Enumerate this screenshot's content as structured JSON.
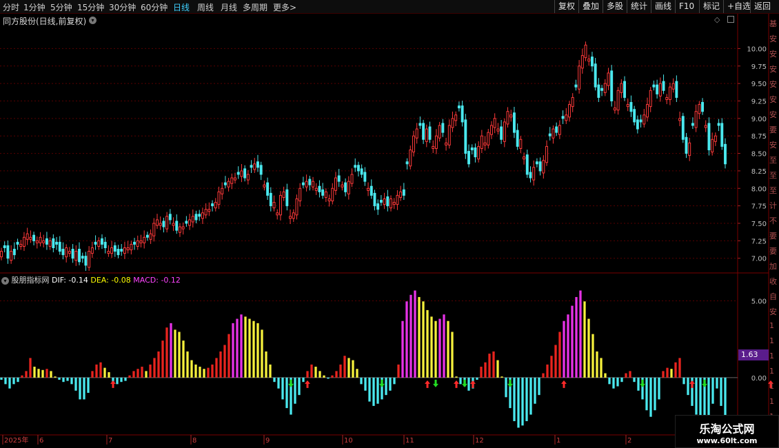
{
  "toolbar": {
    "periods": [
      "分时",
      "1分钟",
      "5分钟",
      "15分钟",
      "30分钟",
      "60分钟",
      "日线",
      "周线",
      "月线",
      "多周期",
      "更多"
    ],
    "active_period": "日线",
    "more_arrow": ">",
    "right_buttons": [
      "复权",
      "叠加",
      "多股",
      "统计",
      "画线",
      "F10",
      "标记",
      "+自选",
      "返回"
    ]
  },
  "stock": {
    "title": "同方股份(日线,前复权)"
  },
  "indicator": {
    "name": "股朋指标网",
    "dif_label": "DIF: -0.14",
    "dea_label": "DEA: -0.08",
    "macd_label": "MACD: -0.12",
    "current_value_tag": "1.63",
    "colors": {
      "dif": "#ffffff",
      "dea": "#ffff00",
      "macd": "#ff44ff",
      "tag_bg": "#5a1c8c"
    }
  },
  "side_panel_chars": [
    "基",
    "安",
    "安",
    "安",
    "安",
    "安",
    "安",
    "要",
    "安",
    "至",
    "至",
    "至",
    "计",
    "不",
    "要",
    "要",
    "加",
    "收",
    "自",
    "安",
    "1",
    "1",
    "1",
    "1",
    "1",
    "1",
    "1"
  ],
  "watermark": {
    "line1": "乐淘公式网",
    "line2": "www.60lt.com"
  },
  "colors": {
    "up": "#ff3a3a",
    "down": "#4ae8ee",
    "grid": "#5a0000",
    "bar_yellow": "#f5f03c",
    "bar_red": "#e8241e",
    "bar_magenta": "#e632e6",
    "bar_cyan": "#4ae8ee",
    "arrow_up": "#ff2a2a",
    "arrow_down": "#22dd22"
  },
  "chart_data": [
    {
      "type": "candlestick",
      "title": "同方股份(日线,前复权)",
      "ylim": [
        6.8,
        10.3
      ],
      "y_ticks": [
        7.0,
        7.25,
        7.5,
        7.75,
        8.0,
        8.25,
        8.5,
        8.75,
        9.0,
        9.25,
        9.5,
        9.75,
        10.0
      ],
      "y_tick_labels": [
        "7.00",
        "7.25",
        "7.50",
        "7.75",
        "8.00",
        "8.25",
        "8.50",
        "8.75",
        "9.00",
        "9.25",
        "9.50",
        "9.75",
        "10.00"
      ],
      "x_labels": [
        "2025年",
        "6",
        "7",
        "8",
        "9",
        "10",
        "11",
        "12",
        "1",
        "2"
      ],
      "close": [
        7.1,
        7.15,
        7.0,
        7.1,
        7.05,
        7.2,
        7.2,
        7.3,
        7.35,
        7.3,
        7.25,
        7.25,
        7.3,
        7.25,
        7.2,
        7.25,
        7.15,
        7.2,
        7.1,
        7.05,
        7.15,
        7.1,
        7.0,
        7.1,
        6.95,
        7.0,
        6.9,
        7.1,
        7.15,
        7.2,
        7.25,
        7.2,
        7.15,
        7.1,
        7.15,
        7.1,
        7.05,
        7.1,
        7.15,
        7.15,
        7.2,
        7.2,
        7.25,
        7.25,
        7.3,
        7.3,
        7.35,
        7.5,
        7.55,
        7.5,
        7.45,
        7.6,
        7.55,
        7.5,
        7.4,
        7.45,
        7.45,
        7.5,
        7.55,
        7.6,
        7.55,
        7.6,
        7.65,
        7.7,
        7.7,
        7.75,
        7.8,
        7.95,
        8.0,
        8.05,
        8.1,
        8.15,
        8.15,
        8.2,
        8.25,
        8.15,
        8.2,
        8.3,
        8.35,
        8.3,
        8.2,
        8.05,
        7.9,
        7.75,
        7.8,
        7.65,
        7.9,
        7.95,
        7.75,
        7.6,
        7.65,
        7.85,
        8.0,
        8.05,
        8.1,
        8.05,
        8.1,
        8.0,
        7.95,
        7.9,
        7.95,
        7.85,
        8.0,
        8.15,
        8.1,
        8.05,
        7.95,
        8.1,
        8.2,
        8.3,
        8.25,
        8.2,
        8.1,
        8.0,
        7.9,
        7.75,
        7.7,
        7.8,
        7.85,
        7.75,
        7.85,
        7.8,
        7.9,
        7.95,
        7.9,
        8.35,
        8.55,
        8.75,
        8.85,
        8.9,
        8.7,
        8.85,
        8.7,
        8.6,
        8.75,
        8.9,
        8.8,
        8.65,
        8.9,
        9.0,
        9.05,
        9.15,
        8.95,
        8.5,
        8.35,
        8.55,
        8.45,
        8.6,
        8.75,
        8.65,
        8.8,
        8.9,
        9.0,
        8.85,
        8.7,
        8.95,
        9.1,
        9.05,
        8.8,
        8.6,
        8.7,
        8.45,
        8.2,
        8.15,
        8.3,
        8.35,
        8.25,
        8.4,
        8.6,
        8.75,
        8.85,
        8.8,
        8.9,
        9.0,
        9.05,
        9.2,
        9.3,
        9.45,
        9.75,
        9.9,
        10.05,
        9.85,
        9.75,
        9.45,
        9.3,
        9.4,
        9.5,
        9.65,
        9.25,
        9.15,
        9.4,
        9.5,
        9.3,
        9.2,
        9.1,
        8.95,
        8.85,
        8.95,
        9.05,
        9.2,
        9.4,
        9.45,
        9.35,
        9.5,
        9.4,
        9.3,
        9.45,
        9.5,
        9.3,
        9.0,
        8.7,
        8.5,
        8.65,
        8.9,
        9.1,
        9.2,
        9.1,
        8.9,
        8.55,
        8.7,
        8.75,
        8.9,
        8.6,
        8.35
      ],
      "overlay_series": [
        {
          "name": "DIF",
          "color": "#ffffff"
        },
        {
          "name": "DEA",
          "color": "#ffff00"
        }
      ]
    },
    {
      "type": "bar",
      "title": "股朋指标网",
      "ylim": [
        -2.6,
        4.3
      ],
      "y_ticks": [
        0.0,
        5.0
      ],
      "y_tick_labels": [
        "0.00",
        "5.00"
      ],
      "values": [
        -0.1,
        -0.3,
        -0.5,
        -0.3,
        -0.2,
        0.1,
        0.3,
        0.9,
        0.5,
        0.4,
        0.35,
        0.4,
        0.3,
        0.05,
        -0.1,
        -0.2,
        -0.15,
        -0.3,
        -0.6,
        -1.0,
        -1.0,
        -0.7,
        0.3,
        0.6,
        0.7,
        0.45,
        0.25,
        -0.2,
        -0.3,
        -0.2,
        -0.15,
        0.1,
        0.3,
        0.4,
        0.5,
        0.3,
        0.6,
        0.9,
        1.2,
        1.7,
        2.3,
        2.5,
        2.2,
        2.1,
        1.7,
        1.2,
        0.8,
        0.6,
        0.5,
        0.4,
        0.45,
        0.6,
        0.9,
        1.2,
        1.5,
        2.0,
        2.5,
        2.7,
        2.9,
        2.8,
        2.7,
        2.6,
        2.5,
        2.2,
        1.2,
        0.6,
        -0.2,
        -0.5,
        -1.0,
        -1.4,
        -1.7,
        -1.2,
        -0.8,
        -0.2,
        0.3,
        0.6,
        0.5,
        0.3,
        0.1,
        -0.05,
        0.1,
        0.3,
        0.6,
        1.0,
        0.9,
        0.8,
        0.4,
        -0.3,
        -0.6,
        -1.1,
        -1.3,
        -1.2,
        -1.0,
        -0.8,
        -0.6,
        -0.3,
        0.6,
        2.6,
        3.5,
        3.8,
        4.0,
        3.7,
        3.5,
        3.1,
        2.8,
        2.6,
        2.7,
        2.9,
        2.6,
        2.1,
        0.05,
        -0.3,
        -0.4,
        -0.6,
        -0.5,
        -0.1,
        0.5,
        0.7,
        1.1,
        1.2,
        0.8,
        0.05,
        -0.9,
        -1.4,
        -2.0,
        -2.3,
        -2.2,
        -2.0,
        -1.7,
        -1.2,
        -0.8,
        0.2,
        0.6,
        1.0,
        1.5,
        2.1,
        2.6,
        2.9,
        3.3,
        3.7,
        4.0,
        3.5,
        2.7,
        2.0,
        1.2,
        0.9,
        0.2,
        -0.3,
        -0.5,
        -0.4,
        -0.2,
        0.2,
        0.3,
        -0.2,
        -0.6,
        -1.0,
        -1.5,
        -1.8,
        -1.5,
        -1.0,
        0.3,
        0.45,
        0.4,
        0.7,
        0.9,
        -0.3,
        -0.8,
        -1.3,
        -1.7,
        -2.1,
        -2.3,
        -1.9,
        -1.2,
        -0.5,
        -1.3,
        -2.2
      ],
      "signals": [
        {
          "index": 27,
          "type": "buy"
        },
        {
          "index": 70,
          "type": "sell"
        },
        {
          "index": 74,
          "type": "buy"
        },
        {
          "index": 92,
          "type": "sell"
        },
        {
          "index": 103,
          "type": "buy"
        },
        {
          "index": 105,
          "type": "sell"
        },
        {
          "index": 110,
          "type": "buy"
        },
        {
          "index": 112,
          "type": "sell"
        },
        {
          "index": 114,
          "type": "buy"
        },
        {
          "index": 123,
          "type": "sell"
        },
        {
          "index": 136,
          "type": "buy"
        },
        {
          "index": 155,
          "type": "sell"
        },
        {
          "index": 167,
          "type": "buy"
        },
        {
          "index": 170,
          "type": "sell"
        },
        {
          "index": 186,
          "type": "buy"
        },
        {
          "index": 205,
          "type": "sell"
        },
        {
          "index": 228,
          "type": "buy"
        },
        {
          "index": 242,
          "type": "sell"
        }
      ]
    }
  ]
}
